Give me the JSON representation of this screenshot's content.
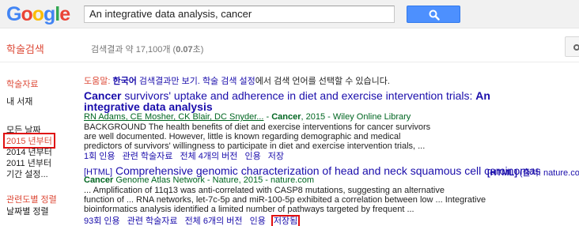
{
  "logo": {
    "letters": [
      "G",
      "o",
      "o",
      "g",
      "l",
      "e"
    ],
    "colors": [
      "#4285f4",
      "#ea4335",
      "#fbbc05",
      "#4285f4",
      "#34a853",
      "#ea4335"
    ]
  },
  "search": {
    "query": "An integrative data analysis, cancer"
  },
  "header": {
    "scholar_title": "학술검색",
    "count_prefix": "검색결과 약 17,100개 (",
    "count_time": "0.07",
    "count_suffix": "초)"
  },
  "sidebar": {
    "articles": "학술자료",
    "my_library": "내 서재",
    "any_time": "모든 날짜",
    "since_2015": "2015 년부터",
    "since_2014": "2014 년부터",
    "since_2011": "2011 년부터",
    "custom_range": "기간 설정...",
    "sort_relevance": "관련도별 정렬",
    "sort_date": "날짜별 정렬"
  },
  "notice": {
    "label": "도움말:",
    "korean": "한국어",
    "text1": " 검색결과만 보기. ",
    "settings_link": "학술 검색 설정",
    "text2": "에서 검색 언어를 선택할 수 있습니다."
  },
  "results": [
    {
      "title_bold1": "Cancer",
      "title_mid": " survivors' uptake and adherence in diet and exercise intervention trials: ",
      "title_bold2": "An",
      "title_line2": "integrative data analysis",
      "authors": "RN Adams, CE Mosher, CK Blair, DC Snyder...",
      "meta_sep": " - ",
      "meta_bold": "Cancer",
      "meta_rest": ", 2015 - Wiley Online Library",
      "snippet": [
        "BACKGROUND The health benefits of diet and exercise interventions for cancer survivors",
        "are well documented. However, little is known regarding demographic and medical",
        "predictors of survivors' willingness to participate in diet and exercise intervention trials, ..."
      ],
      "links": [
        "1회 인용",
        "관련 학술자료",
        "전체 4개의 버전",
        "인용",
        "저장"
      ]
    },
    {
      "tag": "[HTML]",
      "title": " Comprehensive genomic characterization of head and neck squamous cell carcinomas",
      "meta_bold": "Cancer",
      "meta_rest": " Genome Atlas Network - Nature, 2015 - nature.com",
      "snippet": [
        "... Amplification of 11q13 was anti-correlated with CASP8 mutations, suggesting an alternative",
        "function of ... RNA networks, let-7c-5p and miR-100-5p exhibited a correlation between low ... Integrative",
        "bioinformatics analysis identified a limited number of pathways targeted by frequent ..."
      ],
      "links": [
        "93회 인용",
        "관련 학술자료",
        "전체 6개의 버전",
        "인용",
        "저장됨"
      ],
      "side_html": "[HTML]",
      "side_source": " (출처: nature.co"
    }
  ]
}
